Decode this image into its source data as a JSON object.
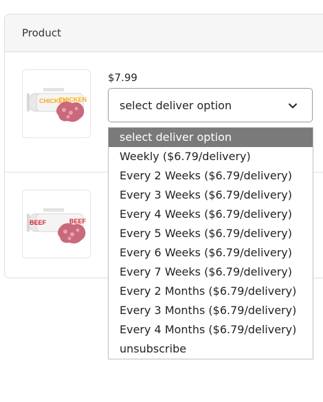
{
  "table": {
    "header": "Product"
  },
  "rows": [
    {
      "product_image": "chicken-roll-image",
      "roll_text": "CHICKEN"
    },
    {
      "product_image": "beef-roll-image",
      "roll_text": "BEEF"
    }
  ],
  "subscription": {
    "price": "$7.99",
    "selected_value": "select deliver option",
    "options": [
      "select deliver option",
      "Weekly ($6.79/delivery)",
      "Every 2 Weeks ($6.79/delivery)",
      "Every 3 Weeks ($6.79/delivery)",
      "Every 4 Weeks ($6.79/delivery)",
      "Every 5 Weeks ($6.79/delivery)",
      "Every 6 Weeks ($6.79/delivery)",
      "Every 7 Weeks ($6.79/delivery)",
      "Every 2 Months ($6.79/delivery)",
      "Every 3 Months ($6.79/delivery)",
      "Every 4 Months ($6.79/delivery)",
      "unsubscribe"
    ],
    "highlighted_index": 0
  },
  "colors": {
    "highlight": "#7a7a7a",
    "chicken_label": "#f2a92c",
    "beef_label": "#d2232a",
    "meat": "#c9697b"
  },
  "icons": {
    "select_chevron": "chevron-down-icon"
  }
}
